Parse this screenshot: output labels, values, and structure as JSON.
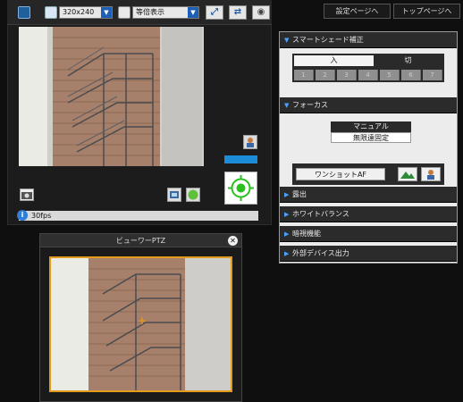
{
  "toolbar": {
    "resolution": "320x240",
    "display_mode": "等倍表示"
  },
  "top_links": {
    "settings_page": "設定ページへ",
    "top_page": "トップページへ"
  },
  "status": {
    "fps": "30fps"
  },
  "smart_shade": {
    "title": "スマートシェード補正",
    "on_label": "入",
    "off_label": "切",
    "levels": [
      "1",
      "2",
      "3",
      "4",
      "5",
      "6",
      "7"
    ]
  },
  "focus": {
    "title": "フォーカス",
    "manual_label": "マニュアル",
    "infinity_label": "無限遠固定",
    "one_shot_af": "ワンショットAF"
  },
  "sections": {
    "exposure": "露出",
    "white_balance": "ホワイトバランス",
    "dark_view": "暗視機能",
    "external_output": "外部デバイス出力"
  },
  "ptz": {
    "title": "ビューワーPTZ",
    "close_glyph": "✕"
  },
  "colors": {
    "accent_blue": "#1d8cd8",
    "ptz_border": "#e49a1a",
    "green_target": "#29c21d"
  }
}
